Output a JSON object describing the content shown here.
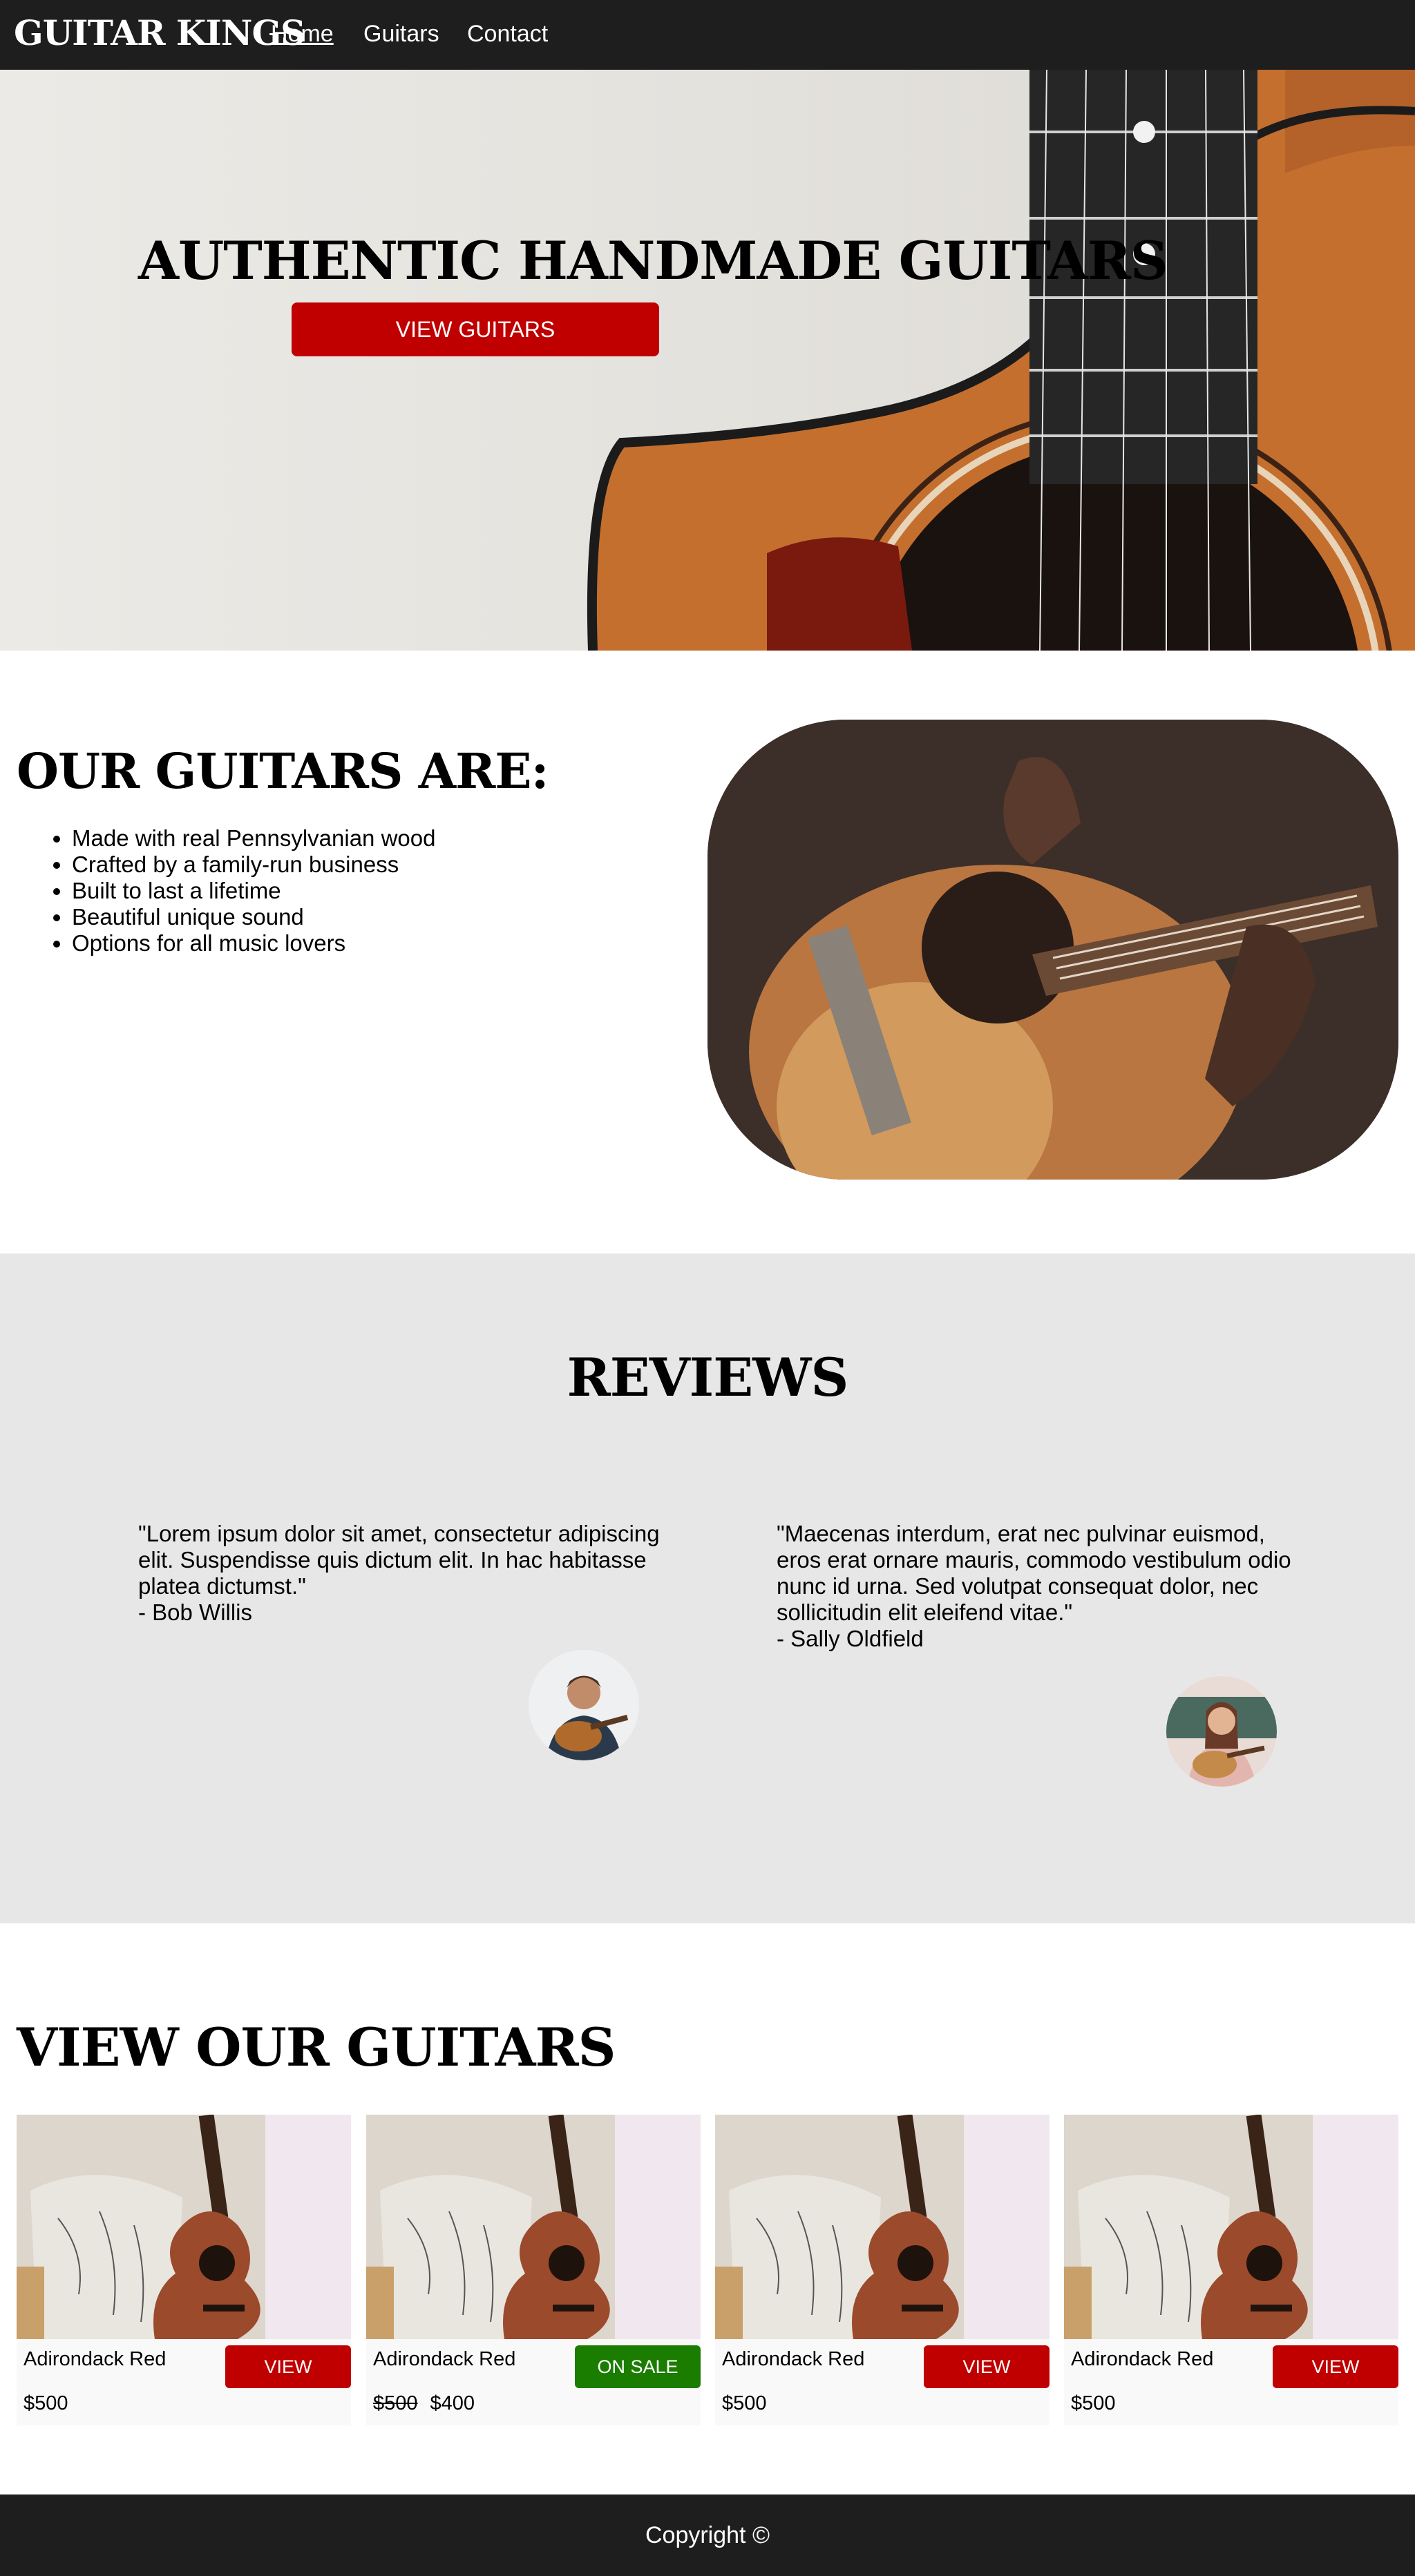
{
  "brand": "GUITAR KINGS",
  "nav": {
    "links": [
      "Home",
      "Guitars",
      "Contact"
    ],
    "active": "Home"
  },
  "hero": {
    "title": "AUTHENTIC HANDMADE GUITARS",
    "button_label": "VIEW GUITARS"
  },
  "features": {
    "title": "OUR GUITARS ARE:",
    "items": [
      "Made with real Pennsylvanian wood",
      "Crafted by a family-run business",
      "Built to last a lifetime",
      "Beautiful unique sound",
      "Options for all music lovers"
    ]
  },
  "reviews": {
    "title": "REVIEWS",
    "items": [
      {
        "quote": "\"Lorem ipsum dolor sit amet, consectetur adipiscing elit. Suspendisse quis dictum elit. In hac habitasse platea dictumst.\"",
        "author": "- Bob Willis"
      },
      {
        "quote": "\"Maecenas interdum, erat nec pulvinar euismod, eros erat ornare mauris, commodo vestibulum odio nunc id urna. Sed volutpat consequat dolor, nec sollicitudin elit eleifend vitae.\"",
        "author": "- Sally Oldfield"
      }
    ]
  },
  "guitars": {
    "title": "VIEW OUR GUITARS",
    "items": [
      {
        "name": "Adirondack Red",
        "price": "$500",
        "old_price": "",
        "button": "VIEW"
      },
      {
        "name": "Adirondack Red",
        "price": "$400",
        "old_price": "$500",
        "button": "ON SALE"
      },
      {
        "name": "Adirondack Red",
        "price": "$500",
        "old_price": "",
        "button": "VIEW"
      },
      {
        "name": "Adirondack Red",
        "price": "$500",
        "old_price": "",
        "button": "VIEW"
      }
    ]
  },
  "footer": {
    "text": "Copyright ©"
  },
  "colors": {
    "nav_bg": "#1e1e1e",
    "accent_red": "#c00000",
    "sale_green": "#1a7d00",
    "reviews_bg": "#e8e7e7"
  }
}
